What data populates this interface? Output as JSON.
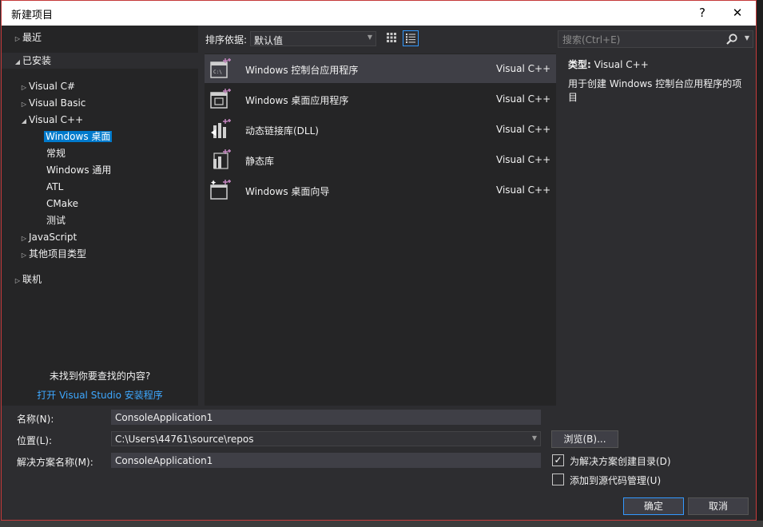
{
  "window": {
    "title": "新建项目",
    "help_glyph": "?",
    "close_glyph": "✕"
  },
  "tree": {
    "recent": "最近",
    "installed": "已安装",
    "items": [
      {
        "label": "Visual C#"
      },
      {
        "label": "Visual Basic"
      },
      {
        "label": "Visual C++"
      },
      {
        "label": "Windows 桌面"
      },
      {
        "label": "常规"
      },
      {
        "label": "Windows 通用"
      },
      {
        "label": "ATL"
      },
      {
        "label": "CMake"
      },
      {
        "label": "测试"
      },
      {
        "label": "JavaScript"
      },
      {
        "label": "其他项目类型"
      }
    ],
    "online": "联机",
    "not_found": "未找到你要查找的内容?",
    "installer_link": "打开 Visual Studio 安装程序"
  },
  "sort": {
    "label": "排序依据:",
    "value": "默认值"
  },
  "templates": [
    {
      "name": "Windows 控制台应用程序",
      "lang": "Visual C++",
      "icon": "console-app-icon"
    },
    {
      "name": "Windows 桌面应用程序",
      "lang": "Visual C++",
      "icon": "desktop-app-icon"
    },
    {
      "name": "动态链接库(DLL)",
      "lang": "Visual C++",
      "icon": "dll-icon"
    },
    {
      "name": "静态库",
      "lang": "Visual C++",
      "icon": "static-lib-icon"
    },
    {
      "name": "Windows 桌面向导",
      "lang": "Visual C++",
      "icon": "desktop-wizard-icon"
    }
  ],
  "search": {
    "placeholder": "搜索(Ctrl+E)"
  },
  "description": {
    "type_key": "类型:",
    "type_value": "Visual C++",
    "text": "用于创建 Windows 控制台应用程序的项目"
  },
  "form": {
    "name_label": "名称(N):",
    "name_value": "ConsoleApplication1",
    "location_label": "位置(L):",
    "location_value": "C:\\Users\\44761\\source\\repos",
    "solution_label": "解决方案名称(M):",
    "solution_value": "ConsoleApplication1",
    "browse": "浏览(B)...",
    "create_dir": "为解决方案创建目录(D)",
    "create_dir_checked": true,
    "source_control": "添加到源代码管理(U)",
    "source_control_checked": false,
    "ok": "确定",
    "cancel": "取消"
  },
  "colors": {
    "accent": "#007acc",
    "link": "#3ea8ff",
    "background": "#2d2d30",
    "panel": "#252526"
  }
}
